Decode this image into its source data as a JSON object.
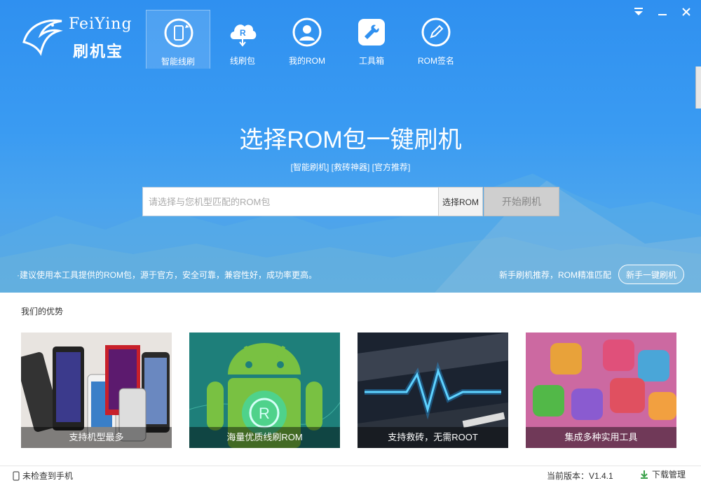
{
  "logo": {
    "brand": "FeiYing",
    "brand_cn": "刷机宝"
  },
  "nav": [
    {
      "label": "智能线刷",
      "icon": "phone-refresh-icon",
      "active": true
    },
    {
      "label": "线刷包",
      "icon": "cloud-download-icon",
      "active": false
    },
    {
      "label": "我的ROM",
      "icon": "user-icon",
      "active": false
    },
    {
      "label": "工具箱",
      "icon": "wrench-icon",
      "active": false
    },
    {
      "label": "ROM签名",
      "icon": "pen-icon",
      "active": false
    }
  ],
  "hero": {
    "title": "选择ROM包一键刷机",
    "tags": "[智能刷机] [救砖神器] [官方推荐]",
    "input_placeholder": "请选择与您机型匹配的ROM包",
    "select_button": "选择ROM",
    "start_button": "开始刷机",
    "tip_left": "·建议使用本工具提供的ROM包，源于官方，安全可靠，兼容性好，成功率更高。",
    "tip_right": "新手刷机推荐，ROM精准匹配",
    "newbie_button": "新手一键刷机"
  },
  "advantages": {
    "title": "我们的优势",
    "cards": [
      {
        "caption": "支持机型最多"
      },
      {
        "caption": "海量优质线刷ROM"
      },
      {
        "caption": "支持救砖，无需ROOT"
      },
      {
        "caption": "集成多种实用工具"
      }
    ]
  },
  "status": {
    "phone": "未检查到手机",
    "version": "当前版本：V1.4.1",
    "download": "下载管理"
  },
  "colors": {
    "primary": "#2f90f0",
    "button_disabled": "#cfcfcf"
  }
}
